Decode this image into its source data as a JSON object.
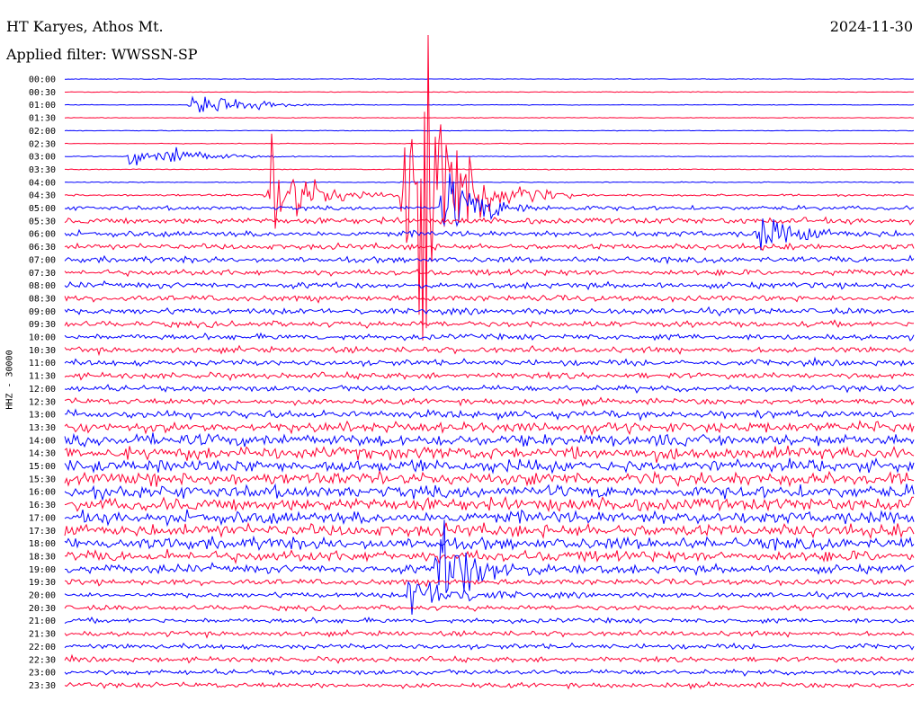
{
  "header": {
    "station": "HT Karyes, Athos Mt.",
    "filter": "Applied filter: WWSSN-SP",
    "date": "2024-11-30"
  },
  "chart_data": {
    "type": "helicorder",
    "ylabel": "HHZ - 30000",
    "row_times": [
      "00:00",
      "00:30",
      "01:00",
      "01:30",
      "02:00",
      "02:30",
      "03:00",
      "03:30",
      "04:00",
      "04:30",
      "05:00",
      "05:30",
      "06:00",
      "06:30",
      "07:00",
      "07:30",
      "08:00",
      "08:30",
      "09:00",
      "09:30",
      "10:00",
      "10:30",
      "11:00",
      "11:30",
      "12:00",
      "12:30",
      "13:00",
      "13:30",
      "14:00",
      "14:30",
      "15:00",
      "15:30",
      "16:00",
      "16:30",
      "17:00",
      "17:30",
      "18:00",
      "18:30",
      "19:00",
      "19:30",
      "20:00",
      "20:30",
      "21:00",
      "21:30",
      "22:00",
      "22:30",
      "23:00",
      "23:30"
    ],
    "colors": [
      "#0000ff",
      "#ff0033"
    ],
    "noise_level": [
      0.4,
      0.4,
      0.4,
      0.4,
      0.4,
      0.4,
      0.5,
      0.5,
      0.6,
      1.2,
      2.5,
      3.5,
      3.5,
      3.5,
      3.5,
      3.5,
      3.5,
      3.5,
      3.5,
      3.5,
      3.5,
      3.5,
      3.5,
      3.5,
      3.5,
      3.5,
      4.5,
      6,
      7,
      7.5,
      7.5,
      7.5,
      7.5,
      7.5,
      7.5,
      7.5,
      7,
      6.5,
      5,
      3.5,
      3,
      3,
      3,
      3,
      3,
      3,
      3,
      3
    ],
    "events": [
      {
        "row": 2,
        "minute": 4.5,
        "amplitude": 12
      },
      {
        "row": 2,
        "minute": 5.5,
        "amplitude": 8
      },
      {
        "row": 6,
        "minute": 2.3,
        "amplitude": 10
      },
      {
        "row": 6,
        "minute": 3.6,
        "amplitude": 12
      },
      {
        "row": 9,
        "minute": 7.2,
        "amplitude": 60
      },
      {
        "row": 9,
        "minute": 12,
        "amplitude": 120
      },
      {
        "row": 9,
        "minute": 12.6,
        "amplitude": 110
      },
      {
        "row": 10,
        "minute": 13.4,
        "amplitude": 40
      },
      {
        "row": 12,
        "minute": 24.5,
        "amplitude": 20
      },
      {
        "row": 38,
        "minute": 13.2,
        "amplitude": 50
      },
      {
        "row": 40,
        "minute": 12.2,
        "amplitude": 25
      }
    ]
  }
}
